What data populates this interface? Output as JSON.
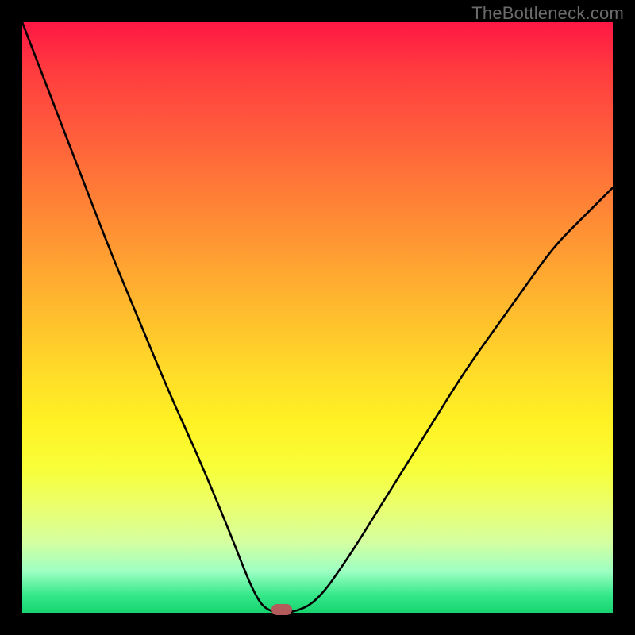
{
  "watermark": "TheBottleneck.com",
  "chart_data": {
    "type": "line",
    "title": "",
    "xlabel": "",
    "ylabel": "",
    "xlim": [
      0,
      1
    ],
    "ylim": [
      0,
      1
    ],
    "grid": false,
    "legend": false,
    "series": [
      {
        "name": "bottleneck-curve",
        "x": [
          0.0,
          0.05,
          0.1,
          0.15,
          0.2,
          0.25,
          0.3,
          0.35,
          0.395,
          0.42,
          0.46,
          0.5,
          0.55,
          0.6,
          0.65,
          0.7,
          0.75,
          0.8,
          0.85,
          0.9,
          0.95,
          1.0
        ],
        "y": [
          1.0,
          0.87,
          0.74,
          0.61,
          0.49,
          0.37,
          0.26,
          0.14,
          0.025,
          0.0,
          0.0,
          0.02,
          0.09,
          0.17,
          0.25,
          0.33,
          0.41,
          0.48,
          0.55,
          0.62,
          0.67,
          0.72
        ]
      }
    ],
    "gradient_stops": [
      {
        "pos": 0.0,
        "color": "#ff1744"
      },
      {
        "pos": 0.5,
        "color": "#ffd829"
      },
      {
        "pos": 0.8,
        "color": "#f7ff3a"
      },
      {
        "pos": 1.0,
        "color": "#17d46f"
      }
    ],
    "marker": {
      "x": 0.44,
      "y": 0.005,
      "color": "#b35a5a"
    }
  }
}
